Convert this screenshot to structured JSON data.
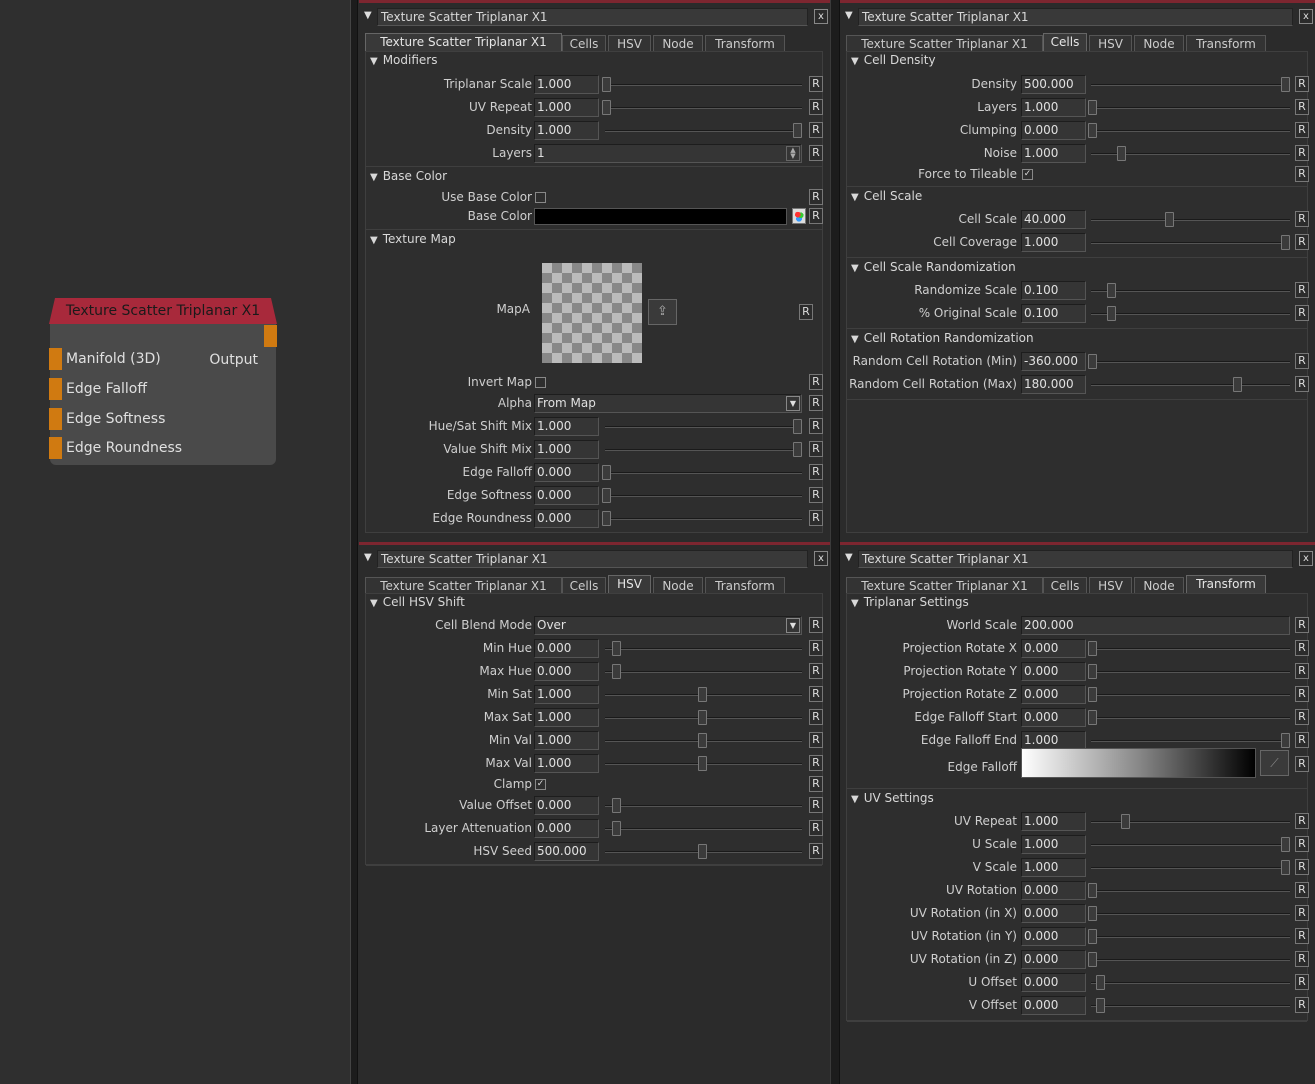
{
  "node": {
    "title": "Texture Scatter Triplanar X1",
    "output": "Output",
    "inputs": [
      "Manifold (3D)",
      "Edge Falloff",
      "Edge Softness",
      "Edge Roundness"
    ],
    "header_color": "#a8293b",
    "port_color": "#d07a11"
  },
  "tabs": [
    "Texture Scatter Triplanar X1",
    "Cells",
    "HSV",
    "Node",
    "Transform"
  ],
  "reset_label": "R",
  "close_label": "x",
  "panels": {
    "main": {
      "title": "Texture Scatter Triplanar X1",
      "modifiers": {
        "header": "Modifiers",
        "triplanar_scale": {
          "label": "Triplanar Scale",
          "value": "1.000",
          "fraction": 0.0
        },
        "uv_repeat": {
          "label": "UV Repeat",
          "value": "1.000",
          "fraction": 0.0
        },
        "density": {
          "label": "Density",
          "value": "1.000",
          "fraction": 1.0
        },
        "layers": {
          "label": "Layers",
          "value": "1"
        }
      },
      "base_color": {
        "header": "Base Color",
        "use_label": "Use Base Color",
        "use_checked": false,
        "color_label": "Base Color",
        "color": "#000000"
      },
      "texture_map": {
        "header": "Texture Map",
        "map_label": "MapA",
        "invert_label": "Invert Map",
        "invert_checked": false,
        "alpha_label": "Alpha",
        "alpha_value": "From Map",
        "hue_sat": {
          "label": "Hue/Sat Shift Mix",
          "value": "1.000",
          "fraction": 1.0
        },
        "value_shift": {
          "label": "Value Shift Mix",
          "value": "1.000",
          "fraction": 1.0
        },
        "edge_falloff": {
          "label": "Edge Falloff",
          "value": "0.000",
          "fraction": 0.0
        },
        "edge_softness": {
          "label": "Edge Softness",
          "value": "0.000",
          "fraction": 0.0
        },
        "edge_roundness": {
          "label": "Edge Roundness",
          "value": "0.000",
          "fraction": 0.0
        }
      }
    },
    "cells": {
      "title": "Texture Scatter Triplanar X1",
      "density_sect": {
        "header": "Cell Density",
        "density": {
          "label": "Density",
          "value": "500.000",
          "fraction": 1.0
        },
        "layers": {
          "label": "Layers",
          "value": "1.000",
          "fraction": 0.0
        },
        "clumping": {
          "label": "Clumping",
          "value": "0.000",
          "fraction": 0.0
        },
        "noise": {
          "label": "Noise",
          "value": "1.000",
          "fraction": 0.15
        },
        "tileable_label": "Force to Tileable",
        "tileable_checked": true
      },
      "scale_sect": {
        "header": "Cell Scale",
        "cell_scale": {
          "label": "Cell Scale",
          "value": "40.000",
          "fraction": 0.4
        },
        "coverage": {
          "label": "Cell Coverage",
          "value": "1.000",
          "fraction": 1.0
        }
      },
      "scale_rand": {
        "header": "Cell Scale Randomization",
        "randomize": {
          "label": "Randomize Scale",
          "value": "0.100",
          "fraction": 0.1
        },
        "original": {
          "label": "% Original Scale",
          "value": "0.100",
          "fraction": 0.1
        }
      },
      "rot_rand": {
        "header": "Cell Rotation Randomization",
        "min": {
          "label": "Random Cell Rotation (Min)",
          "value": "-360.000",
          "fraction": 0.0
        },
        "max": {
          "label": "Random Cell Rotation (Max)",
          "value": "180.000",
          "fraction": 0.75
        }
      }
    },
    "hsv": {
      "title": "Texture Scatter Triplanar X1",
      "header": "Cell HSV Shift",
      "blend_label": "Cell Blend Mode",
      "blend_value": "Over",
      "min_hue": {
        "label": "Min Hue",
        "value": "0.000",
        "fraction": 0.05
      },
      "max_hue": {
        "label": "Max Hue",
        "value": "0.000",
        "fraction": 0.05
      },
      "min_sat": {
        "label": "Min Sat",
        "value": "1.000",
        "fraction": 0.5
      },
      "max_sat": {
        "label": "Max Sat",
        "value": "1.000",
        "fraction": 0.5
      },
      "min_val": {
        "label": "Min Val",
        "value": "1.000",
        "fraction": 0.5
      },
      "max_val": {
        "label": "Max Val",
        "value": "1.000",
        "fraction": 0.5
      },
      "clamp_label": "Clamp",
      "clamp_checked": true,
      "value_offset": {
        "label": "Value Offset",
        "value": "0.000",
        "fraction": 0.05
      },
      "layer_atten": {
        "label": "Layer Attenuation",
        "value": "0.000",
        "fraction": 0.05
      },
      "hsv_seed": {
        "label": "HSV Seed",
        "value": "500.000",
        "fraction": 0.5
      }
    },
    "transform": {
      "title": "Texture Scatter Triplanar X1",
      "triplanar": {
        "header": "Triplanar Settings",
        "world_scale": {
          "label": "World Scale",
          "value": "200.000"
        },
        "rot_x": {
          "label": "Projection Rotate X",
          "value": "0.000",
          "fraction": 0.0
        },
        "rot_y": {
          "label": "Projection Rotate Y",
          "value": "0.000",
          "fraction": 0.0
        },
        "rot_z": {
          "label": "Projection Rotate Z",
          "value": "0.000",
          "fraction": 0.0
        },
        "falloff_start": {
          "label": "Edge Falloff Start",
          "value": "0.000",
          "fraction": 0.0
        },
        "falloff_end": {
          "label": "Edge Falloff End",
          "value": "1.000",
          "fraction": 1.0
        },
        "edge_falloff_label": "Edge Falloff"
      },
      "uv": {
        "header": "UV Settings",
        "uv_repeat": {
          "label": "UV Repeat",
          "value": "1.000",
          "fraction": 0.17
        },
        "u_scale": {
          "label": "U Scale",
          "value": "1.000",
          "fraction": 1.0
        },
        "v_scale": {
          "label": "V Scale",
          "value": "1.000",
          "fraction": 1.0
        },
        "uv_rot": {
          "label": "UV Rotation",
          "value": "0.000",
          "fraction": 0.0
        },
        "uv_rot_x": {
          "label": "UV Rotation (in X)",
          "value": "0.000",
          "fraction": 0.0
        },
        "uv_rot_y": {
          "label": "UV Rotation (in Y)",
          "value": "0.000",
          "fraction": 0.0
        },
        "uv_rot_z": {
          "label": "UV Rotation (in Z)",
          "value": "0.000",
          "fraction": 0.0
        },
        "u_offset": {
          "label": "U Offset",
          "value": "0.000",
          "fraction": 0.04
        },
        "v_offset": {
          "label": "V Offset",
          "value": "0.000",
          "fraction": 0.04
        }
      }
    }
  }
}
